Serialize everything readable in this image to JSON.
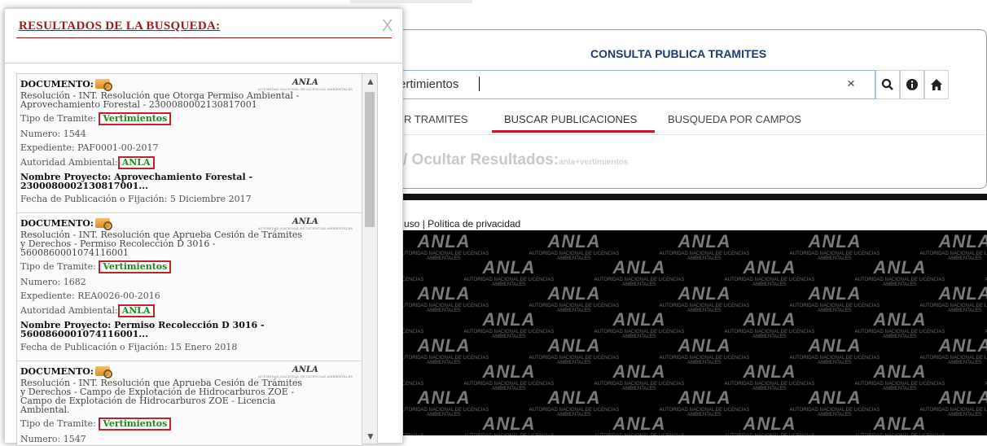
{
  "background": {
    "title": "CONSULTA PUBLICA TRAMITES",
    "search_value": "ertimientos",
    "clear_symbol": "×",
    "tools": [
      "search-icon",
      "info-icon",
      "home-icon"
    ],
    "tabs": [
      {
        "label": "R TRAMITES",
        "active": false
      },
      {
        "label": "BUSCAR PUBLICACIONES",
        "active": true
      },
      {
        "label": "BUSQUEDA POR CAMPOS",
        "active": false
      }
    ],
    "toggle_results": "/ Ocultar Resultados:",
    "toggle_query": "anla+vertimientos",
    "footer": {
      "left": "uso",
      "sep": " | ",
      "privacy": "Política de privacidad"
    },
    "logo": {
      "word": "ANLA",
      "line1": "AUTORIDAD NACIONAL",
      "line2": "DE LICENCIAS AMBIENTALES"
    },
    "accent_color": "#c8102e"
  },
  "modal": {
    "title": "RESULTADOS DE LA BUSQUEDA:",
    "close": "X",
    "results": [
      {
        "doc_label": "DOCUMENTO:",
        "description": "Resolución - INT. Resolución que Otorga Permiso Ambiental - Aprovechamiento Forestal - 2300080002130817001",
        "tipo_label": "Tipo de Tramite:",
        "tipo_value": "Vertimientos",
        "numero": "Numero: 1544",
        "expediente": "Expediente: PAF0001-00-2017",
        "autoridad_label": "Autoridad Ambiental:",
        "autoridad_value": "ANLA",
        "proyecto": "Nombre Proyecto: Aprovechamiento Forestal - 2300080002130817001...",
        "fecha": "Fecha de Publicación o Fijación: 5 Diciembre 2017"
      },
      {
        "doc_label": "DOCUMENTO:",
        "description": "Resolución - INT. Resolución que Aprueba Cesión de Trámites y Derechos - Permiso Recolección D 3016 - 5600860001074116001",
        "tipo_label": "Tipo de Tramite:",
        "tipo_value": "Vertimientos",
        "numero": "Numero: 1682",
        "expediente": "Expediente: REA0026-00-2016",
        "autoridad_label": "Autoridad Ambiental:",
        "autoridad_value": "ANLA",
        "proyecto": "Nombre Proyecto: Permiso Recolección D 3016 - 5600860001074116001...",
        "fecha": "Fecha de Publicación o Fijación: 15 Enero 2018"
      },
      {
        "doc_label": "DOCUMENTO:",
        "description": "Resolución - INT. Resolución que Aprueba Cesión de Trámites y Derechos - Campo de Explotación de Hidrocarburos ZOE - Campo de Explotación de Hidrocarburos ZOE - Licencia Ambiental.",
        "tipo_label": "Tipo de Tramite:",
        "tipo_value": "Vertimientos",
        "numero": "Numero: 1547"
      }
    ],
    "logo_word": "ANLA",
    "logo_sub": "AUTORIDAD NACIONAL DE LICENCIAS AMBIENTALES",
    "scroll_up": "▲",
    "scroll_down": "▼"
  }
}
